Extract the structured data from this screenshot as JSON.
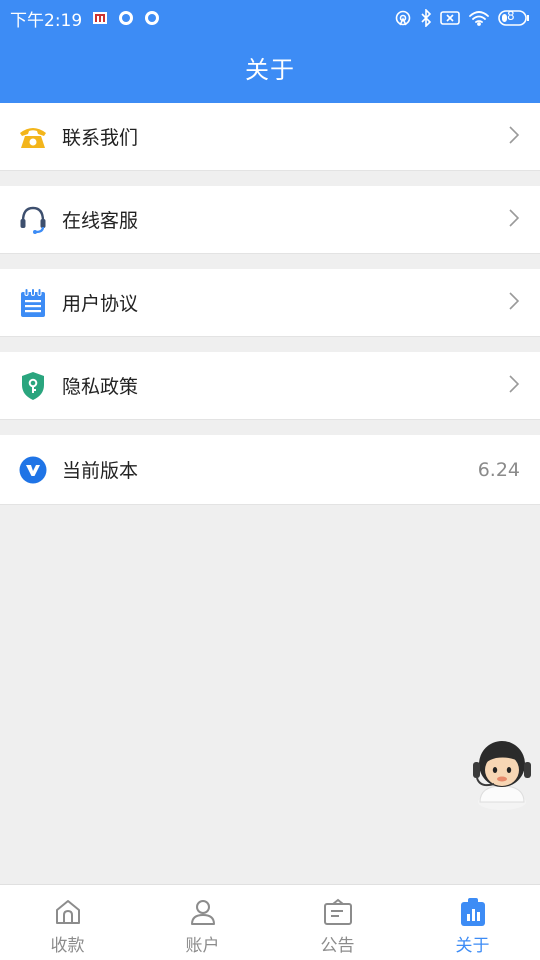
{
  "status": {
    "time": "下午2:19",
    "battery": "8"
  },
  "header": {
    "title": "关于"
  },
  "menu": [
    {
      "label": "联系我们"
    },
    {
      "label": "在线客服"
    },
    {
      "label": "用户协议"
    },
    {
      "label": "隐私政策"
    }
  ],
  "version": {
    "label": "当前版本",
    "value": "6.24"
  },
  "tabs": [
    {
      "label": "收款",
      "icon": "home-icon"
    },
    {
      "label": "账户",
      "icon": "user-icon"
    },
    {
      "label": "公告",
      "icon": "notice-icon"
    },
    {
      "label": "关于",
      "icon": "chart-bag-icon",
      "active": true
    }
  ],
  "colors": {
    "accent": "#3d8cf5",
    "phone": "#f3b51b",
    "shield": "#2aa57e",
    "brand": "#1f74e6"
  }
}
